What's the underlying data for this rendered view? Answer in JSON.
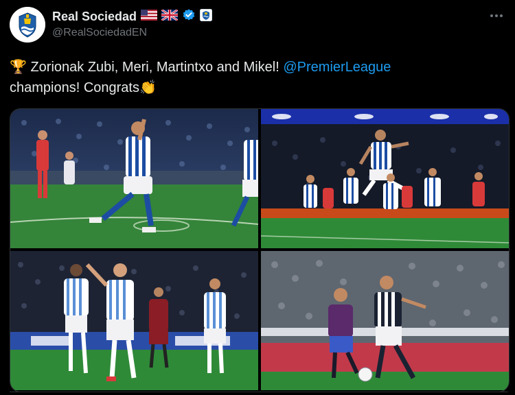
{
  "post": {
    "display_name": "Real Sociedad",
    "handle": "@RealSociedadEN",
    "text_emoji": "🏆",
    "text_before": " Zorionak Zubi, Meri, Martintxo and Mikel! ",
    "mention": "@PremierLeague",
    "text_line2": "champions! Congrats",
    "text_end_emoji": "👏"
  },
  "badges": [
    "us-flag-icon",
    "uk-flag-icon",
    "verified-badge-icon",
    "club-affiliate-icon"
  ],
  "colors": {
    "background": "#000000",
    "text": "#e7e9ea",
    "secondary": "#71767b",
    "link": "#1d9bf0",
    "verified": "#1d9bf0"
  },
  "gallery": {
    "photos": [
      {
        "description": "Player celebrating with fist raised on pitch"
      },
      {
        "description": "Player leaping in celebration with teammates"
      },
      {
        "description": "Players celebrating with arms raised"
      },
      {
        "description": "Player dribbling the ball past opponent"
      }
    ]
  }
}
